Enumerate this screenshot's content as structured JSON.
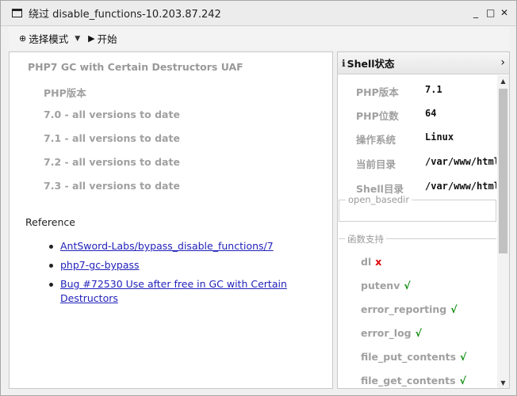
{
  "window": {
    "title": "绕过 disable_functions-10.203.87.242",
    "controls": {
      "minimize": "_",
      "maximize": "□",
      "close": "✕"
    }
  },
  "toolbar": {
    "mode_glyph": "⊕",
    "mode_label": "选择模式",
    "mode_caret": "▼",
    "start_glyph": "▶",
    "start_label": "开始"
  },
  "main": {
    "heading": "PHP7 GC with Certain Destructors UAF",
    "php_version_label": "PHP版本",
    "versions": [
      "7.0 - all versions to date",
      "7.1 - all versions to date",
      "7.2 - all versions to date",
      "7.3 - all versions to date"
    ],
    "reference_label": "Reference",
    "references": [
      "AntSword-Labs/bypass_disable_functions/7",
      "php7-gc-bypass",
      "Bug #72530 Use after free in GC with Certain Destructors"
    ]
  },
  "shell_panel": {
    "icon": "ℹ",
    "title": "Shell状态",
    "chevron": "›",
    "info": [
      {
        "key": "PHP版本",
        "value": "7.1"
      },
      {
        "key": "PHP位数",
        "value": "64"
      },
      {
        "key": "操作系统",
        "value": "Linux"
      },
      {
        "key": "当前目录",
        "value": "/var/www/html"
      },
      {
        "key": "Shell目录",
        "value": "/var/www/html"
      }
    ],
    "open_basedir_label": "open_basedir",
    "functions_label": "函数支持",
    "functions": [
      {
        "name": "dl",
        "mark": "x"
      },
      {
        "name": "putenv",
        "mark": "√"
      },
      {
        "name": "error_reporting",
        "mark": "√"
      },
      {
        "name": "error_log",
        "mark": "√"
      },
      {
        "name": "file_put_contents",
        "mark": "√"
      },
      {
        "name": "file_get_contents",
        "mark": "√"
      }
    ]
  },
  "colors": {
    "link": "#2222bb",
    "supported": "#0a8a0a",
    "unsupported": "#e00000",
    "muted_text": "#a0a0a0"
  }
}
